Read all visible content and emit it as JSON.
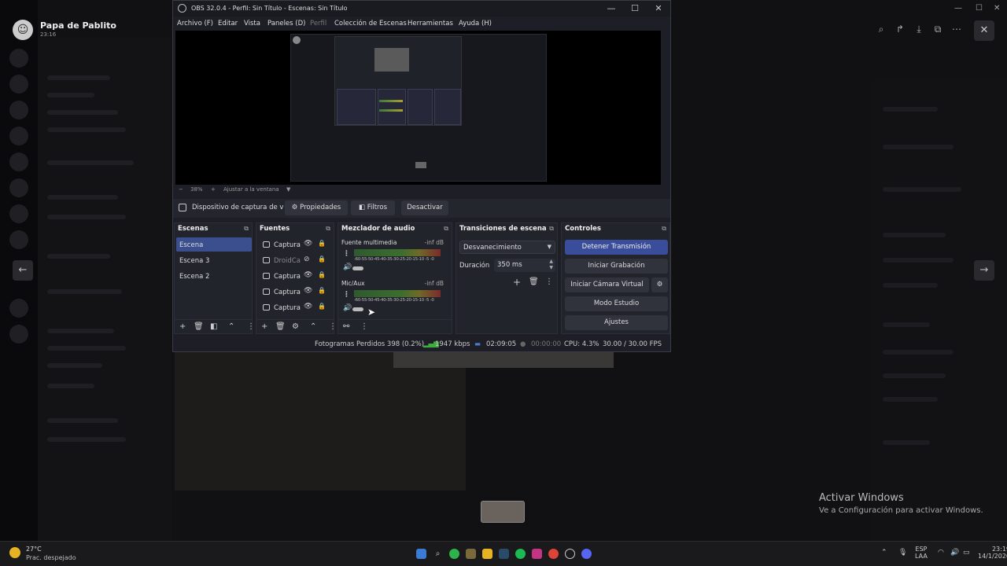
{
  "viewer": {
    "user_name": "Papa de Pablito",
    "user_time": "23:16",
    "activate_title": "Activar Windows",
    "activate_sub": "Ve a Configuración para activar Windows."
  },
  "obs": {
    "title": "OBS 32.0.4 - Perfil: Sin Título - Escenas: Sin Título",
    "menu": [
      "Archivo (F)",
      "Editar",
      "Vista",
      "Paneles (D)",
      "Perfil",
      "Colección de Escenas",
      "Herramientas",
      "Ayuda (H)"
    ],
    "zoom": {
      "pct": "38%",
      "fit": "Ajustar a la ventana"
    },
    "source_bar": {
      "label": "Dispositivo de captura de v",
      "properties": "Propiedades",
      "filters": "Filtros",
      "deactivate": "Desactivar"
    },
    "docks": {
      "scenes": "Escenas",
      "sources": "Fuentes",
      "mixer": "Mezclador de audio",
      "transitions": "Transiciones de escena",
      "controls": "Controles"
    },
    "scenes": [
      "Escena",
      "Escena 3",
      "Escena 2"
    ],
    "sources": [
      "Captura",
      "DroidCa",
      "Captura",
      "Captura",
      "Captura"
    ],
    "mixer": [
      {
        "name": "Fuente multimedia",
        "db": "-inf dB",
        "level": 0.0
      },
      {
        "name": "Mic/Aux",
        "db": "-inf dB",
        "level": 0.0
      }
    ],
    "meter_ticks": "-60-55-50-45-40-35-30-25-20-15-10 -5 -0",
    "transition": {
      "type": "Desvanecimiento",
      "duration_label": "Duración",
      "duration_value": "350 ms"
    },
    "controls": [
      "Detener Transmisión",
      "Iniciar Grabación",
      "Iniciar Cámara Virtual",
      "Modo Estudio",
      "Ajustes"
    ],
    "status": {
      "dropped": "Fotogramas Perdidos 398 (0.2%)",
      "bitrate": "1947 kbps",
      "stream_time": "02:09:05",
      "rec_time": "00:00:00",
      "cpu": "CPU: 4.3%",
      "fps": "30.00 / 30.00 FPS"
    }
  },
  "taskbar": {
    "temp": "27°C",
    "weather": "Prac. despejado",
    "lang1": "ESP",
    "lang2": "LAA",
    "time": "23:19",
    "date": "14/1/2026"
  },
  "colors": {
    "accent": "#3b4f8f",
    "primary_button": "#3a4d9a"
  }
}
